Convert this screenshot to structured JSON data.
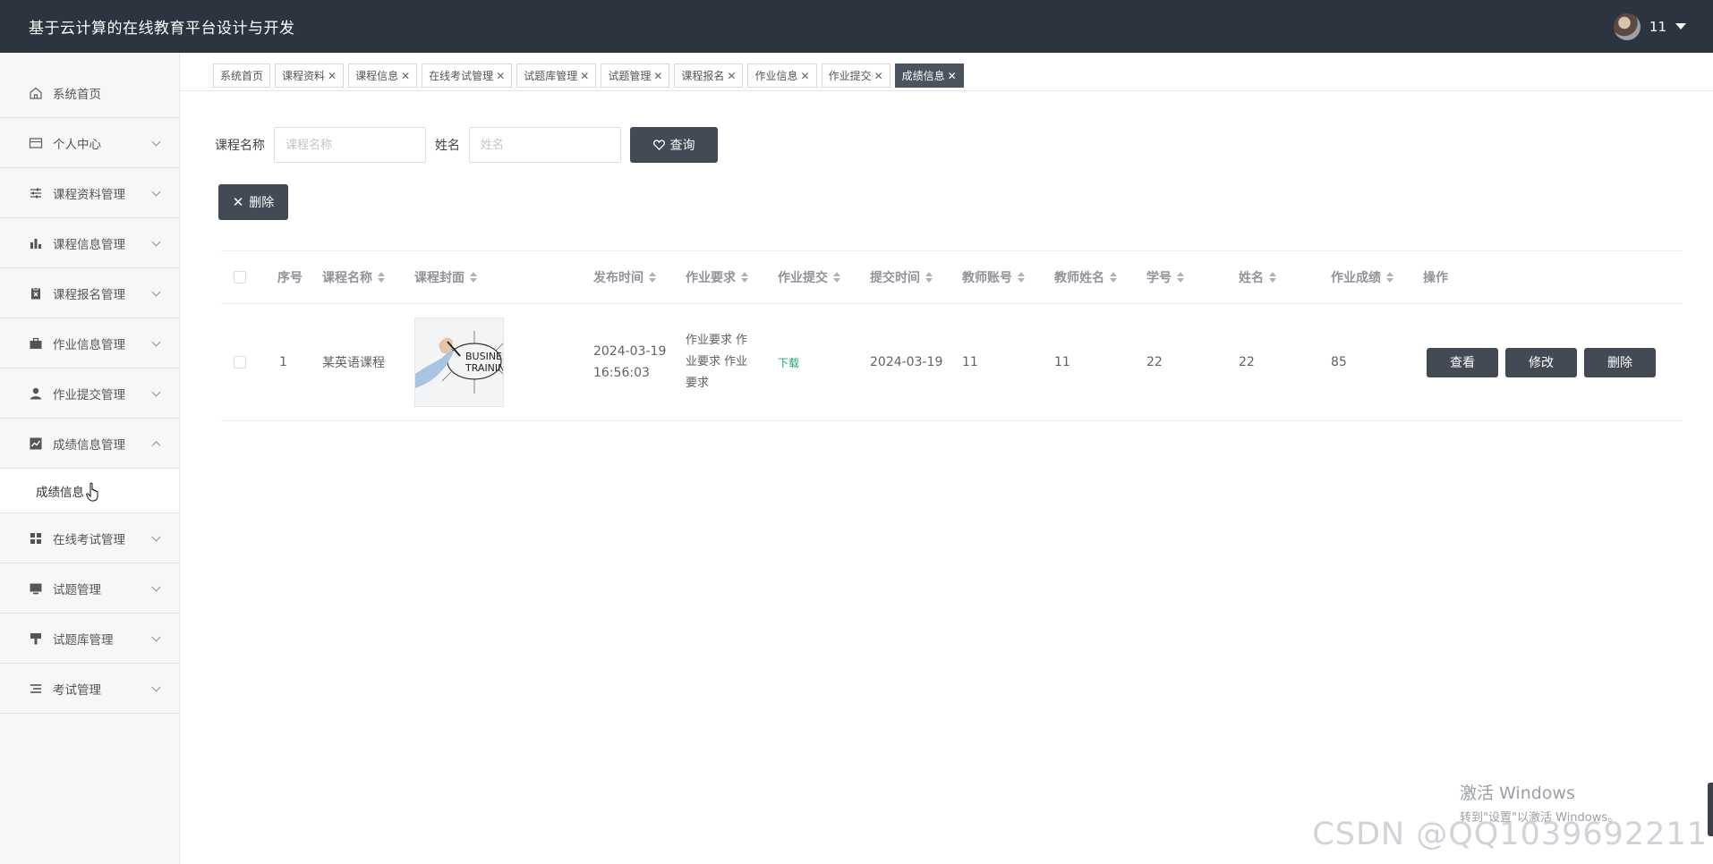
{
  "header": {
    "title": "基于云计算的在线教育平台设计与开发",
    "username": "11"
  },
  "sidebar": {
    "items": [
      {
        "label": "系统首页",
        "icon": "home-icon",
        "expandable": false
      },
      {
        "label": "个人中心",
        "icon": "card-icon",
        "expandable": true
      },
      {
        "label": "课程资料管理",
        "icon": "sliders-icon",
        "expandable": true
      },
      {
        "label": "课程信息管理",
        "icon": "bar-chart-icon",
        "expandable": true
      },
      {
        "label": "课程报名管理",
        "icon": "clipboard-x-icon",
        "expandable": true
      },
      {
        "label": "作业信息管理",
        "icon": "briefcase-icon",
        "expandable": true
      },
      {
        "label": "作业提交管理",
        "icon": "user-icon",
        "expandable": true
      },
      {
        "label": "成绩信息管理",
        "icon": "trend-chart-icon",
        "expandable": true,
        "expanded": true
      },
      {
        "label": "在线考试管理",
        "icon": "grid-icon",
        "expandable": true
      },
      {
        "label": "试题管理",
        "icon": "monitor-icon",
        "expandable": true
      },
      {
        "label": "试题库管理",
        "icon": "stamp-icon",
        "expandable": true
      },
      {
        "label": "考试管理",
        "icon": "list-icon",
        "expandable": true
      }
    ],
    "submenu": {
      "label": "成绩信息"
    }
  },
  "tabs": [
    {
      "label": "系统首页",
      "closable": false
    },
    {
      "label": "课程资料",
      "closable": true
    },
    {
      "label": "课程信息",
      "closable": true
    },
    {
      "label": "在线考试管理",
      "closable": true
    },
    {
      "label": "试题库管理",
      "closable": true
    },
    {
      "label": "试题管理",
      "closable": true
    },
    {
      "label": "课程报名",
      "closable": true
    },
    {
      "label": "作业信息",
      "closable": true
    },
    {
      "label": "作业提交",
      "closable": true
    },
    {
      "label": "成绩信息",
      "closable": true,
      "active": true
    }
  ],
  "search": {
    "course_label": "课程名称",
    "course_placeholder": "课程名称",
    "name_label": "姓名",
    "name_placeholder": "姓名",
    "query_button": "查询"
  },
  "toolbar": {
    "delete_button": "删除"
  },
  "table": {
    "columns": [
      "序号",
      "课程名称",
      "课程封面",
      "发布时间",
      "作业要求",
      "作业提交",
      "提交时间",
      "教师账号",
      "教师姓名",
      "学号",
      "姓名",
      "作业成绩",
      "操作"
    ],
    "rows": [
      {
        "index": "1",
        "course_name": "某英语课程",
        "cover_text": "BUSINESS TRAINING",
        "publish_time_date": "2024-03-19",
        "publish_time_clock": "16:56:03",
        "requirement_l1": "作业要求 作",
        "requirement_l2": "业要求 作业",
        "requirement_l3": "要求",
        "submission": "下载",
        "submit_time": "2024-03-19",
        "teacher_account": "11",
        "teacher_name": "11",
        "student_no": "22",
        "student_name": "22",
        "score": "85",
        "actions": {
          "view": "查看",
          "edit": "修改",
          "delete": "删除"
        }
      }
    ]
  },
  "watermarks": {
    "windows_line1": "激活 Windows",
    "windows_line2": "转到\"设置\"以激活 Windows。",
    "csdn": "CSDN @QQ1039692211"
  },
  "colors": {
    "header_bg": "#2c3440",
    "button_bg": "#434a55",
    "active_tab_bg": "#4b535e",
    "link_green": "#1aa56e"
  }
}
